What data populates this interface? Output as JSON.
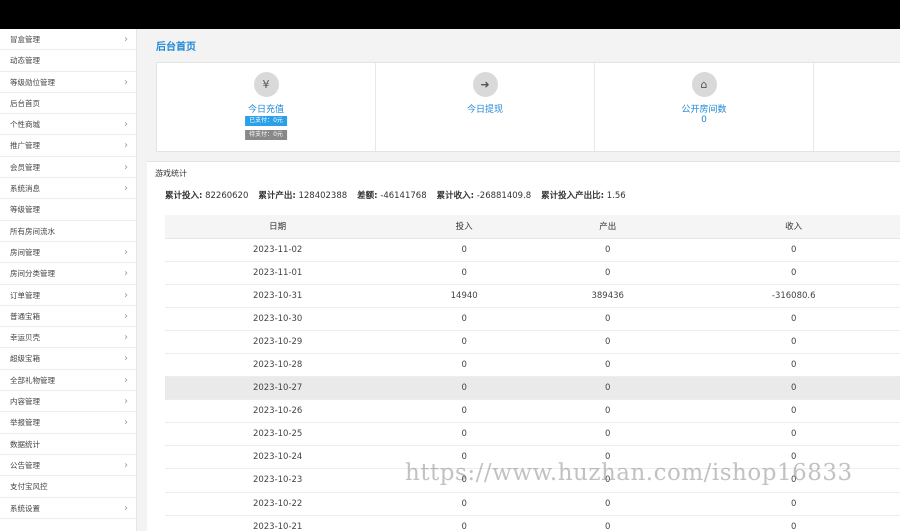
{
  "sidebar": {
    "items": [
      {
        "label": "冒盒管理",
        "chevron": true
      },
      {
        "label": "动态管理",
        "chevron": false
      },
      {
        "label": "等级勋位管理",
        "chevron": true
      },
      {
        "label": "后台首页",
        "chevron": false
      },
      {
        "label": "个性商城",
        "chevron": true
      },
      {
        "label": "推广管理",
        "chevron": true
      },
      {
        "label": "会员管理",
        "chevron": true
      },
      {
        "label": "系统消息",
        "chevron": true
      },
      {
        "label": "等级管理",
        "chevron": false
      },
      {
        "label": "所有房间流水",
        "chevron": false
      },
      {
        "label": "房间管理",
        "chevron": true
      },
      {
        "label": "房间分类管理",
        "chevron": true
      },
      {
        "label": "订单管理",
        "chevron": true
      },
      {
        "label": "普通宝箱",
        "chevron": true
      },
      {
        "label": "幸运贝壳",
        "chevron": true
      },
      {
        "label": "超级宝箱",
        "chevron": true
      },
      {
        "label": "全部礼物管理",
        "chevron": true
      },
      {
        "label": "内容管理",
        "chevron": true
      },
      {
        "label": "举报管理",
        "chevron": true
      },
      {
        "label": "数据统计",
        "chevron": false
      },
      {
        "label": "公告管理",
        "chevron": true
      },
      {
        "label": "支付宝风控",
        "chevron": false
      },
      {
        "label": "系统设置",
        "chevron": true
      }
    ],
    "chevron_glyph": "›"
  },
  "main": {
    "page_title": "后台首页",
    "cards": [
      {
        "icon": "money-icon",
        "glyph": "¥",
        "label": "今日充值",
        "paid": "已支付：0元",
        "unpaid": "待支付：0元"
      },
      {
        "icon": "withdraw-icon",
        "glyph": "➜",
        "label": "今日提现"
      },
      {
        "icon": "home-icon",
        "glyph": "⌂",
        "label": "公开房间数",
        "value": "0"
      }
    ]
  },
  "stats": {
    "title": "游戏统计",
    "summary": [
      {
        "label": "累计投入:",
        "value": "82260620"
      },
      {
        "label": "累计产出:",
        "value": "128402388"
      },
      {
        "label": "差额:",
        "value": "-46141768"
      },
      {
        "label": "累计收入:",
        "value": "-26881409.8"
      },
      {
        "label": "累计投入产出比:",
        "value": "1.56"
      }
    ],
    "columns": [
      "日期",
      "投入",
      "产出",
      "收入"
    ],
    "rows": [
      [
        "2023-11-02",
        "0",
        "0",
        "0"
      ],
      [
        "2023-11-01",
        "0",
        "0",
        "0"
      ],
      [
        "2023-10-31",
        "14940",
        "389436",
        "-316080.6"
      ],
      [
        "2023-10-30",
        "0",
        "0",
        "0"
      ],
      [
        "2023-10-29",
        "0",
        "0",
        "0"
      ],
      [
        "2023-10-28",
        "0",
        "0",
        "0"
      ],
      [
        "2023-10-27",
        "0",
        "0",
        "0"
      ],
      [
        "2023-10-26",
        "0",
        "0",
        "0"
      ],
      [
        "2023-10-25",
        "0",
        "0",
        "0"
      ],
      [
        "2023-10-24",
        "0",
        "0",
        "0"
      ],
      [
        "2023-10-23",
        "0",
        "0",
        "0"
      ],
      [
        "2023-10-22",
        "0",
        "0",
        "0"
      ],
      [
        "2023-10-21",
        "0",
        "0",
        "0"
      ]
    ],
    "highlight_row": 6
  },
  "watermark": "https://www.huzhan.com/ishop16833"
}
